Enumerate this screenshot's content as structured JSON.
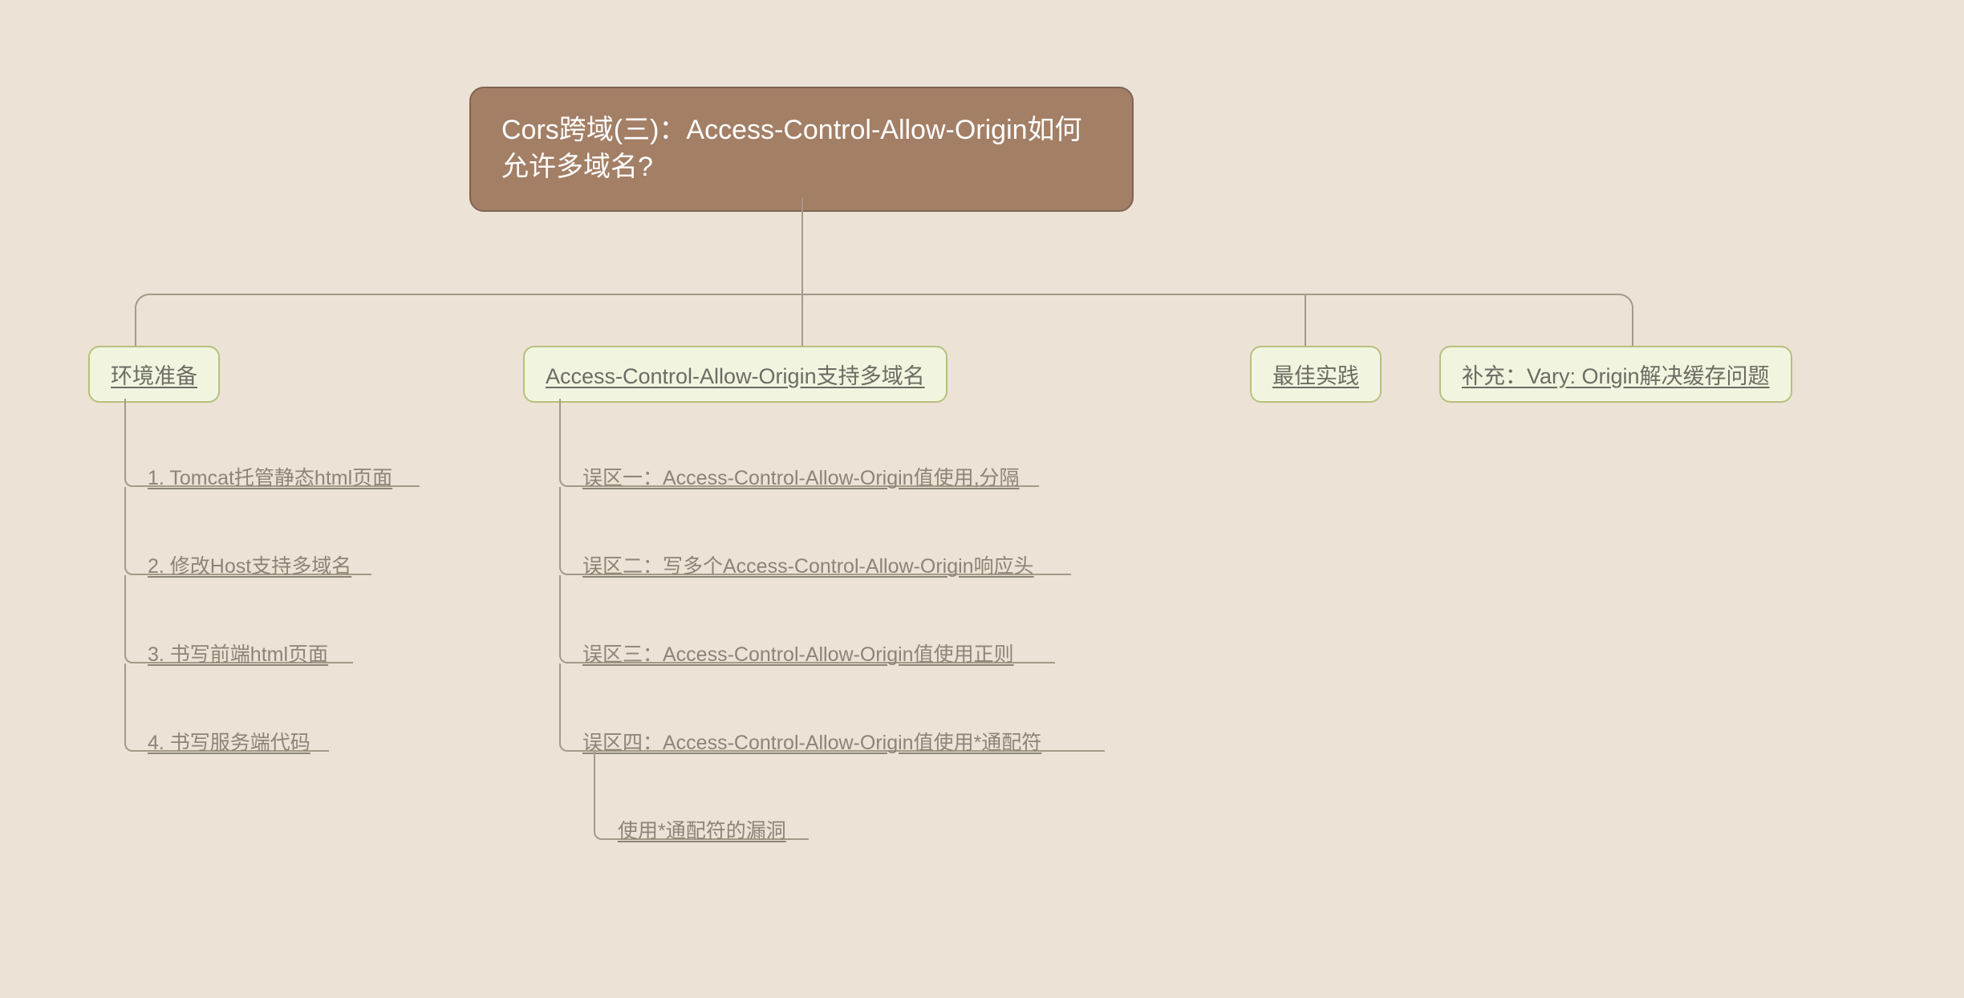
{
  "root": {
    "title": "Cors跨域(三)：Access-Control-Allow-Origin如何允许多域名?"
  },
  "branches": {
    "b1": {
      "label": "环境准备"
    },
    "b2": {
      "label": "Access-Control-Allow-Origin支持多域名"
    },
    "b3": {
      "label": "最佳实践"
    },
    "b4": {
      "label": "补充：Vary: Origin解决缓存问题"
    }
  },
  "leaves": {
    "b1": {
      "l1": "1. Tomcat托管静态html页面",
      "l2": "2. 修改Host支持多域名",
      "l3": "3. 书写前端html页面",
      "l4": "4. 书写服务端代码"
    },
    "b2": {
      "l1": "误区一：Access-Control-Allow-Origin值使用,分隔",
      "l2": "误区二：写多个Access-Control-Allow-Origin响应头",
      "l3": "误区三：Access-Control-Allow-Origin值使用正则",
      "l4": "误区四：Access-Control-Allow-Origin值使用*通配符",
      "l4_child": "使用*通配符的漏洞"
    }
  }
}
